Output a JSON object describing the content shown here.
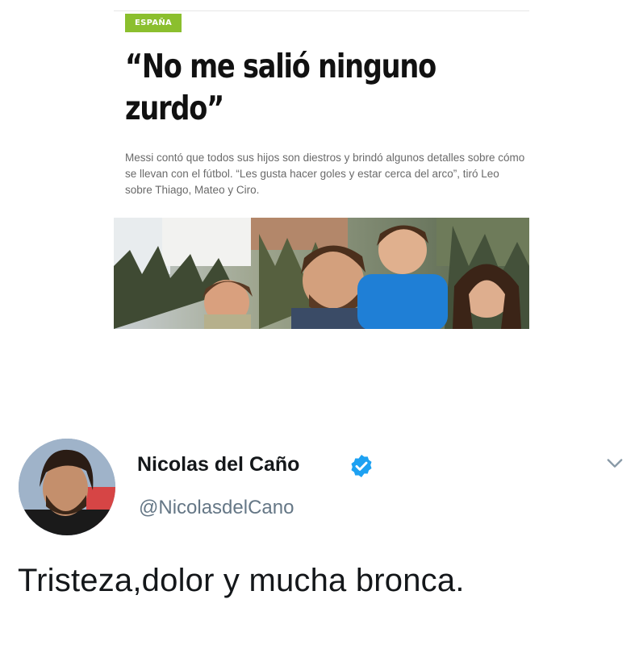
{
  "article": {
    "section_tag": "ESPAÑA",
    "headline": "“No me salió ninguno zurdo”",
    "summary": "Messi contó que todos sus hijos son diestros y brindó algunos detalles sobre cómo se llevan con el fútbol. “Les gusta hacer goles y estar cerca del arco”, tiró Leo sobre Thiago, Mateo y Ciro.",
    "photo_alt": "family-photo",
    "tag_color": "#8bbf2e"
  },
  "tweet": {
    "display_name": "Nicolas del Caño",
    "handle": "@NicolasdelCano",
    "text": "Tristeza,dolor y mucha bronca.",
    "verified_color": "#1da1f2",
    "icons": {
      "verified": "verified-badge-icon",
      "menu": "chevron-down-icon"
    }
  }
}
